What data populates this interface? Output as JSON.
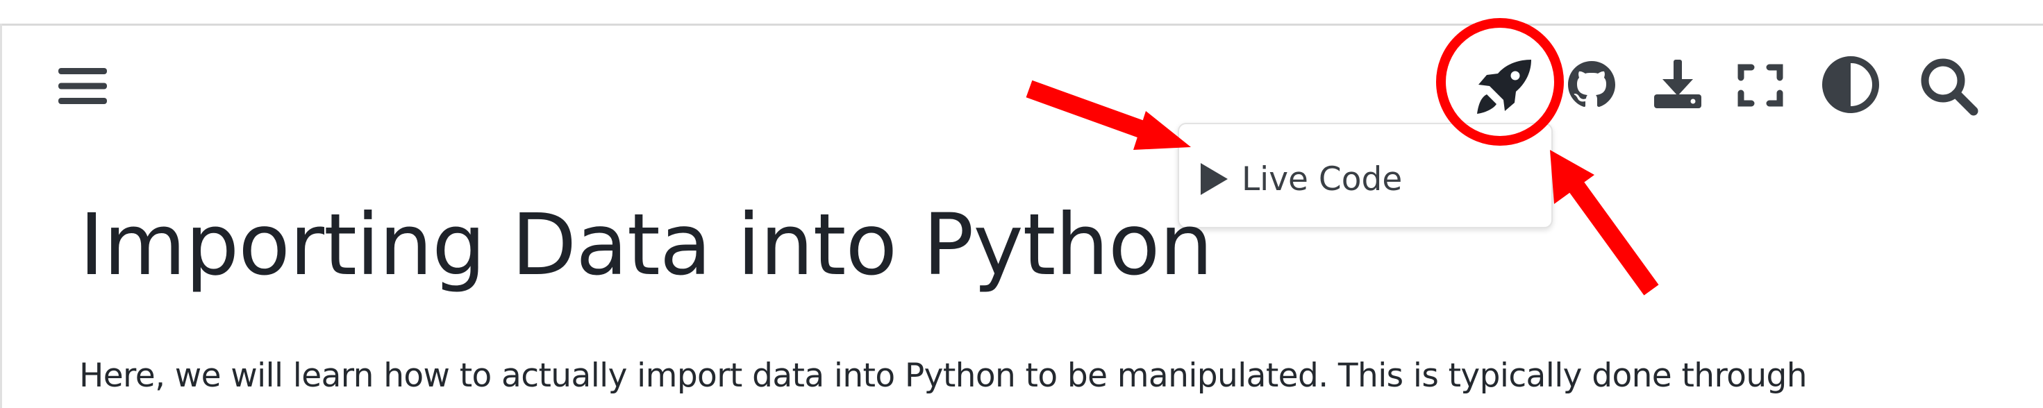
{
  "header": {
    "icons": [
      "menu-icon",
      "rocket-icon",
      "github-icon",
      "download-icon",
      "fullscreen-icon",
      "theme-contrast-icon",
      "search-icon"
    ]
  },
  "launch_menu": {
    "items": [
      {
        "label": "Live Code",
        "icon": "play-icon"
      }
    ]
  },
  "article": {
    "title": "Importing Data into Python",
    "intro": "Here, we will learn how to actually import data into Python to be manipulated. This is typically done through"
  },
  "annotation": {
    "color": "#ff0000"
  }
}
